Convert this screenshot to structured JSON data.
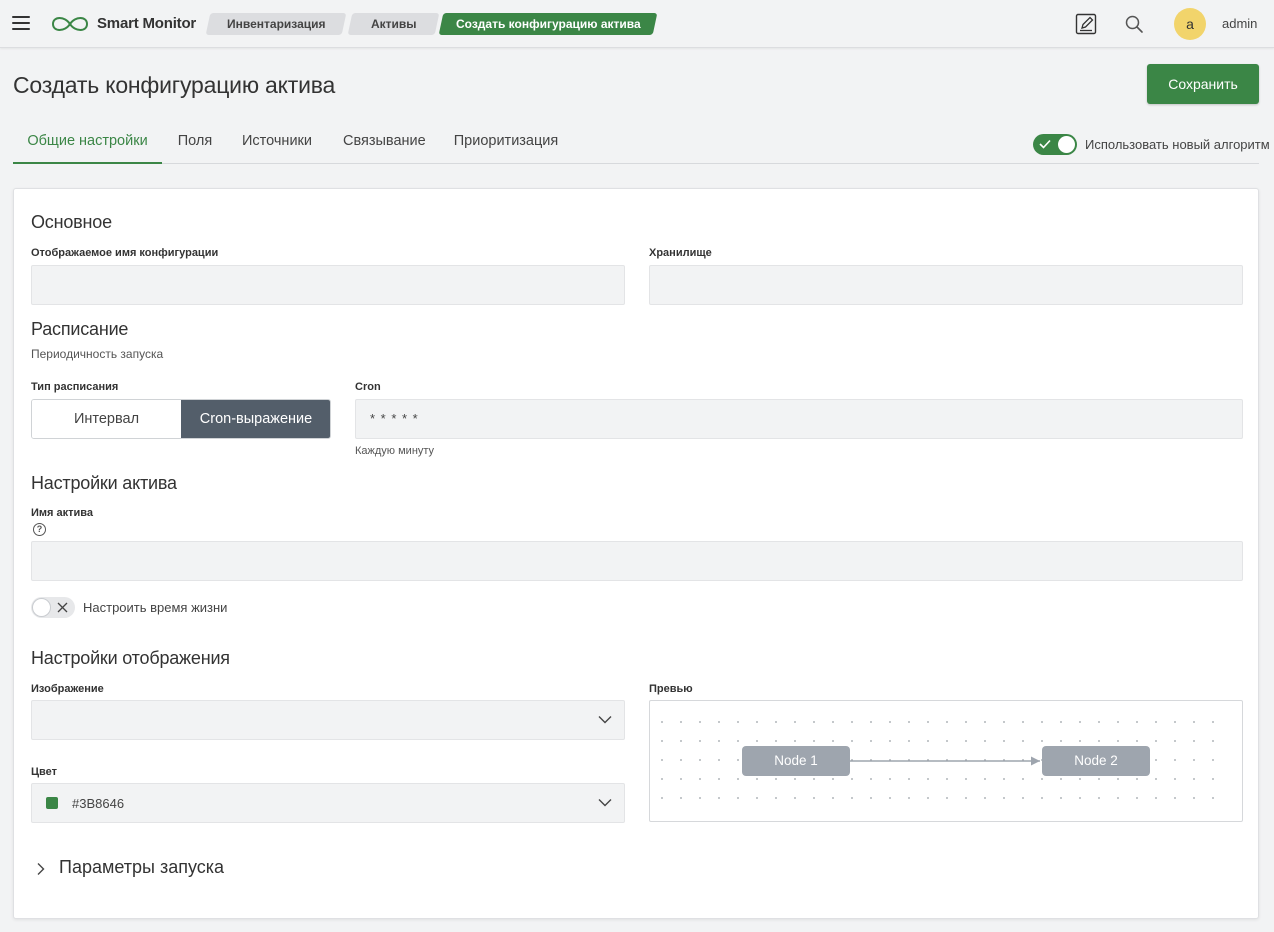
{
  "header": {
    "brand": "Smart Monitor",
    "breadcrumbs": [
      "Инвентаризация",
      "Активы",
      "Создать конфигурацию актива"
    ],
    "user": {
      "avatar_letter": "a",
      "name": "admin"
    },
    "icons": [
      "menu-icon",
      "edit-icon",
      "search-icon"
    ]
  },
  "page": {
    "title": "Создать конфигурацию актива",
    "save_label": "Сохранить",
    "tabs": [
      "Общие настройки",
      "Поля",
      "Источники",
      "Связывание",
      "Приоритизация"
    ],
    "active_tab": "Общие настройки",
    "algo_toggle": {
      "label": "Использовать новый алгоритм",
      "on": true
    }
  },
  "basic": {
    "heading": "Основное",
    "display_name_label": "Отображаемое имя конфигурации",
    "display_name_value": "",
    "storage_label": "Хранилище",
    "storage_value": ""
  },
  "schedule": {
    "heading": "Расписание",
    "subtitle": "Периодичность запуска",
    "type_label": "Тип расписания",
    "options": [
      "Интервал",
      "Cron-выражение"
    ],
    "selected": "Cron-выражение",
    "cron_label": "Cron",
    "cron_value": "* * * * *",
    "cron_hint": "Каждую минуту"
  },
  "asset": {
    "heading": "Настройки актива",
    "name_label": "Имя актива",
    "help_glyph": "?",
    "name_value": "",
    "ttl_label": "Настроить время жизни",
    "ttl_on": false
  },
  "display": {
    "heading": "Настройки отображения",
    "image_label": "Изображение",
    "image_value": "",
    "color_label": "Цвет",
    "color_value": "#3B8646",
    "preview_label": "Превью",
    "nodes": [
      "Node 1",
      "Node 2"
    ]
  },
  "launch": {
    "label": "Параметры запуска",
    "expanded": false
  },
  "colors": {
    "accent": "#3b8646",
    "segment_active": "#535e6a",
    "node": "#9ea5ae",
    "avatar": "#f2d46b"
  }
}
